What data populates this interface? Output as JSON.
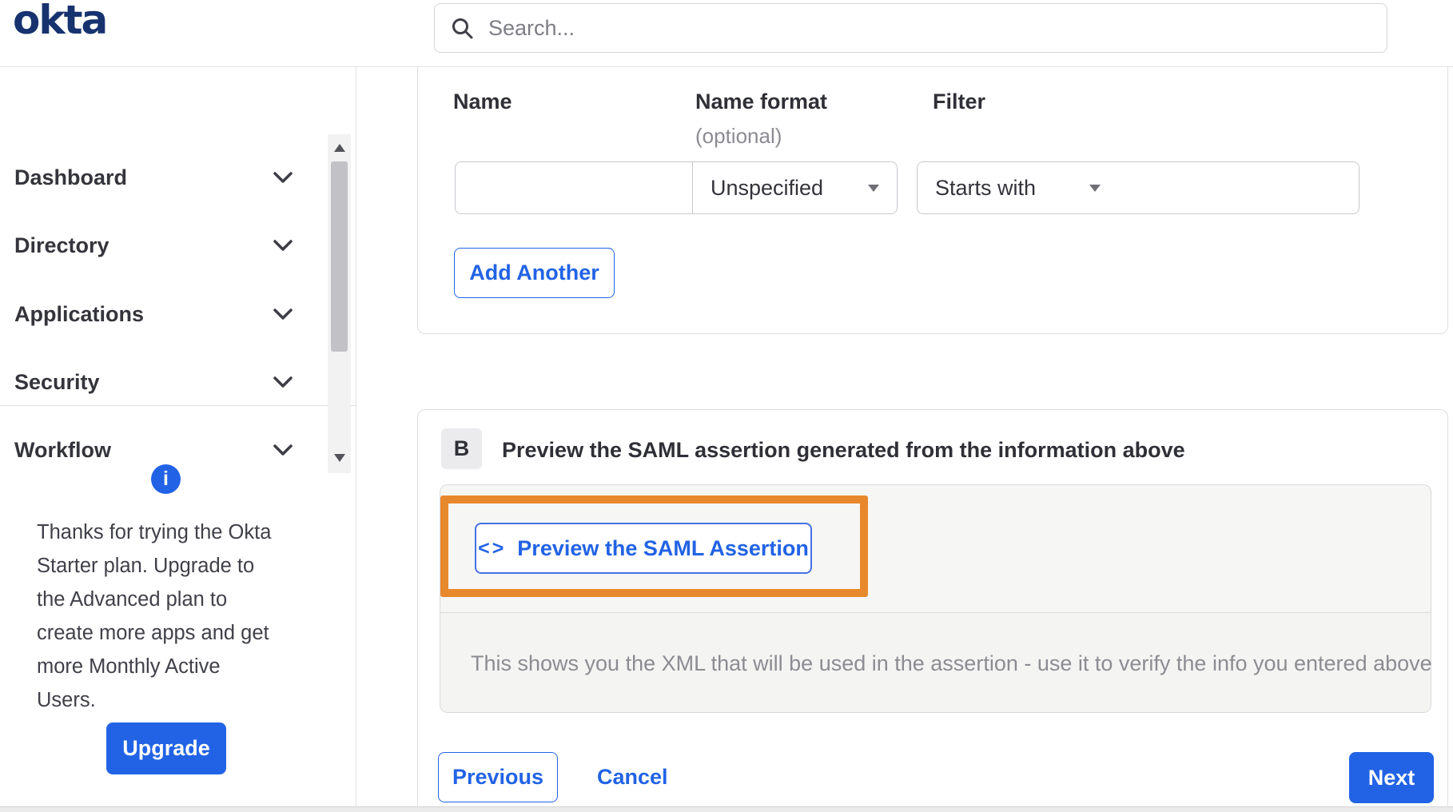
{
  "header": {
    "logo_text": "okta",
    "search_placeholder": "Search..."
  },
  "sidebar": {
    "items": [
      "Dashboard",
      "Directory",
      "Applications",
      "Security",
      "Workflow"
    ],
    "upgrade": {
      "message": "Thanks for trying the Okta Starter plan. Upgrade to the Advanced plan to create more apps and get more Monthly Active Users.",
      "button_label": "Upgrade"
    }
  },
  "attribute_form": {
    "columns": {
      "name_label": "Name",
      "name_format_label": "Name format",
      "name_format_hint": "(optional)",
      "filter_label": "Filter"
    },
    "name_value": "",
    "name_format_selected": "Unspecified",
    "filter_operator_selected": "Starts with",
    "filter_value": "",
    "add_another_label": "Add Another"
  },
  "preview_section": {
    "badge": "B",
    "title": "Preview the SAML assertion generated from the information above",
    "preview_button_label": "Preview the SAML Assertion",
    "description": "This shows you the XML that will be used in the assertion - use it to verify the info you entered above"
  },
  "footer": {
    "previous_label": "Previous",
    "cancel_label": "Cancel",
    "next_label": "Next"
  },
  "icons": {
    "info_glyph": "i",
    "code_glyph": "<>"
  },
  "colors": {
    "primary_blue": "#2263e5",
    "logo_navy": "#17336F",
    "highlight_orange": "#E8882C",
    "panel_gray": "#f6f6f5",
    "muted_text": "#8c8c92"
  }
}
